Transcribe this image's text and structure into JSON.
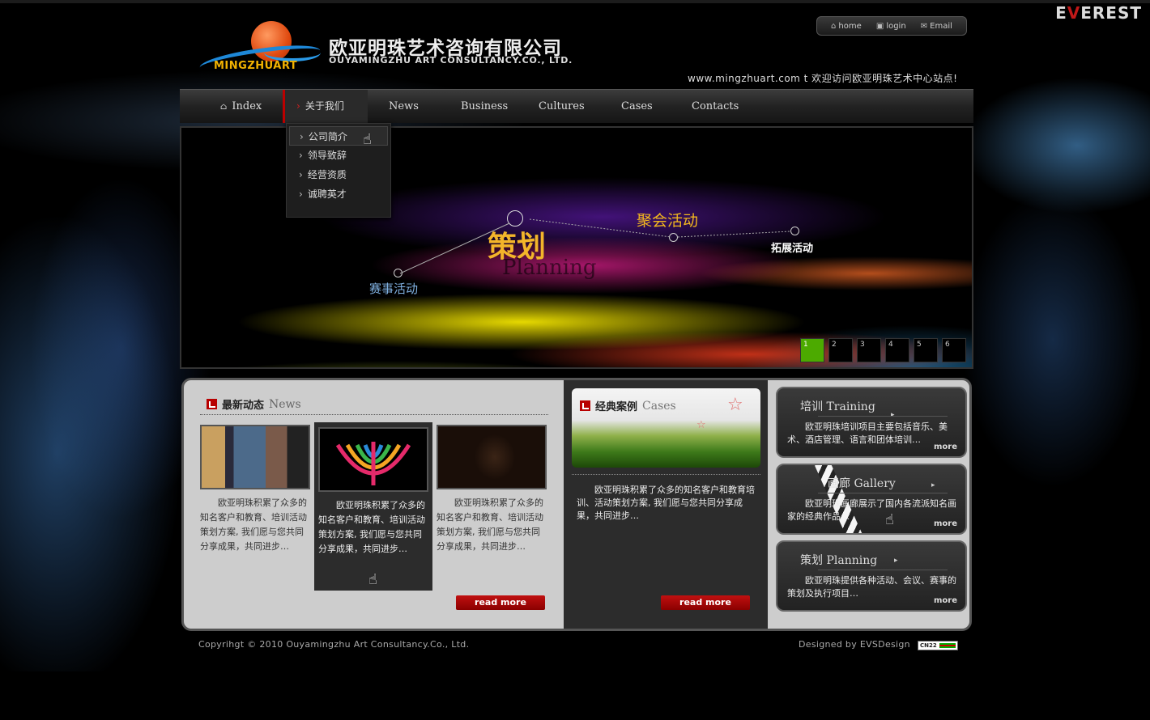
{
  "brand_mark": {
    "pre": "E",
    "accent": "V",
    "post": "EREST"
  },
  "logo": {
    "name": "MINGZHUART"
  },
  "company": {
    "cn": "欧亚明珠艺术咨询有限公司",
    "en": "OUYAMINGZHU ART CONSULTANCY.CO., LTD."
  },
  "toplinks": {
    "home": "home",
    "login": "login",
    "email": "Email"
  },
  "welcome": "www.mingzhuart.com t   欢迎访问欧亚明珠艺术中心站点!",
  "nav": {
    "index": "Index",
    "about": "关于我们",
    "news": "News",
    "business": "Business",
    "cultures": "Cultures",
    "cases": "Cases",
    "contacts": "Contacts"
  },
  "dropdown": [
    "公司简介",
    "领导致辞",
    "经营资质",
    "诚聘英才"
  ],
  "banner": {
    "main": "策划",
    "main_en": "Planning",
    "item_a": "聚会活动",
    "item_b": "拓展活动",
    "item_c": "赛事活动",
    "pages": [
      "1",
      "2",
      "3",
      "4",
      "5",
      "6"
    ],
    "active_page": 1
  },
  "news": {
    "title_cn": "最新动态",
    "title_en": "News",
    "cards": [
      "欧亚明珠积累了众多的知名客户和教育、培训活动策划方案, 我们愿与您共同分享成果，共同进步…",
      "欧亚明珠积累了众多的知名客户和教育、培训活动策划方案, 我们愿与您共同分享成果，共同进步…",
      "欧亚明珠积累了众多的知名客户和教育、培训活动策划方案, 我们愿与您共同分享成果，共同进步…"
    ],
    "read_more": "read more"
  },
  "cases": {
    "title_cn": "经典案例",
    "title_en": "Cases",
    "text": "欧亚明珠积累了众多的知名客户和教育培训、活动策划方案, 我们愿与您共同分享成果，共同进步…",
    "read_more": "read more"
  },
  "right_boxes": [
    {
      "title": "培训  Training",
      "text": "欧亚明珠培训项目主要包括音乐、美术、酒店管理、语言和团体培训…",
      "more": "more"
    },
    {
      "title": "画廊 Gallery",
      "text": "欧亚明珠画廊展示了国内各流派知名画家的经典作品…",
      "more": "more"
    },
    {
      "title": "策划  Planning",
      "text": "欧亚明珠提供各种活动、会议、赛事的策划及执行项目…",
      "more": "more"
    }
  ],
  "footer": {
    "copyright": "Copyrihgt © 2010 Ouyamingzhu Art Consultancy.Co., Ltd.",
    "designed": "Designed by EVSDesign",
    "badge": "CN22"
  },
  "colors": {
    "accent_red": "#b80000",
    "nav_bg": "#222222",
    "active_page": "#4caa00",
    "logo_gold": "#f2b200"
  }
}
